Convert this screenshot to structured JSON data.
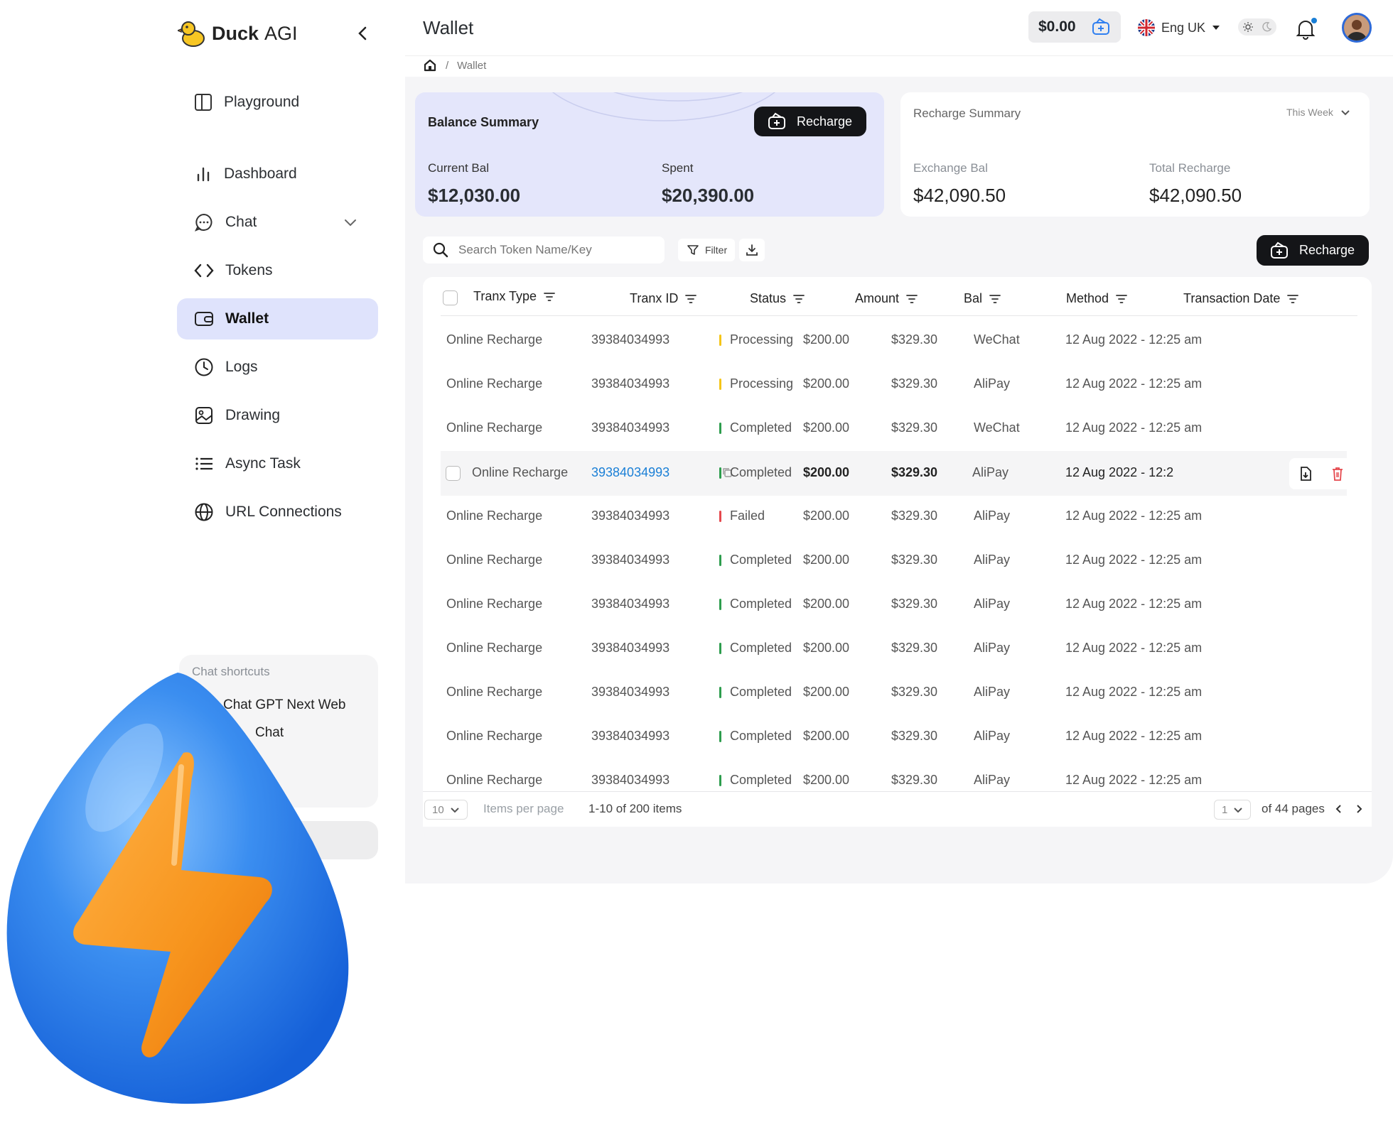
{
  "app": {
    "brand_main": "Duck",
    "brand_accent": "AGI"
  },
  "sidebar": {
    "items": [
      {
        "label": "Playground",
        "icon": "layout-icon"
      },
      {
        "label": "Dashboard",
        "icon": "bar-chart-icon"
      },
      {
        "label": "Chat",
        "icon": "chat-bubble-icon"
      },
      {
        "label": "Tokens",
        "icon": "code-icon"
      },
      {
        "label": "Wallet",
        "icon": "wallet-icon"
      },
      {
        "label": "Logs",
        "icon": "clock-icon"
      },
      {
        "label": "Drawing",
        "icon": "image-icon"
      },
      {
        "label": "Async Task",
        "icon": "list-icon"
      },
      {
        "label": "URL Connections",
        "icon": "globe-icon"
      }
    ],
    "active": "Wallet",
    "shortcuts": {
      "title": "Chat shortcuts",
      "items": [
        "Chat GPT Next Web",
        "Chat"
      ]
    }
  },
  "header": {
    "title": "Wallet",
    "balance": "$0.00",
    "language": "Eng UK",
    "breadcrumb": [
      "Wallet"
    ]
  },
  "balance_summary": {
    "title": "Balance Summary",
    "recharge_label": "Recharge",
    "current_label": "Current Bal",
    "current_value": "$12,030.00",
    "spent_label": "Spent",
    "spent_value": "$20,390.00"
  },
  "recharge_summary": {
    "title": "Recharge Summary",
    "period": "This Week",
    "exchange_label": "Exchange Bal",
    "exchange_value": "$42,090.50",
    "total_label": "Total Recharge",
    "total_value": "$42,090.50"
  },
  "toolbar": {
    "search_placeholder": "Search Token Name/Key",
    "filter_label": "Filter",
    "recharge_label": "Recharge"
  },
  "table": {
    "columns": [
      "Tranx Type",
      "Tranx ID",
      "Status",
      "Amount",
      "Bal",
      "Method",
      "Transaction Date"
    ],
    "rows": [
      {
        "type": "Online Recharge",
        "id": "39384034993",
        "status": "Processing",
        "amount": "$200.00",
        "bal": "$329.30",
        "method": "WeChat",
        "date": "12 Aug 2022 - 12:25 am"
      },
      {
        "type": "Online Recharge",
        "id": "39384034993",
        "status": "Processing",
        "amount": "$200.00",
        "bal": "$329.30",
        "method": "AliPay",
        "date": "12 Aug 2022 - 12:25 am"
      },
      {
        "type": "Online Recharge",
        "id": "39384034993",
        "status": "Completed",
        "amount": "$200.00",
        "bal": "$329.30",
        "method": "WeChat",
        "date": "12 Aug 2022 - 12:25 am"
      },
      {
        "type": "Online Recharge",
        "id": "39384034993",
        "status": "Completed",
        "amount": "$200.00",
        "bal": "$329.30",
        "method": "AliPay",
        "date": "12 Aug 2022 - 12:2"
      },
      {
        "type": "Online Recharge",
        "id": "39384034993",
        "status": "Failed",
        "amount": "$200.00",
        "bal": "$329.30",
        "method": "AliPay",
        "date": "12 Aug 2022 - 12:25 am"
      },
      {
        "type": "Online Recharge",
        "id": "39384034993",
        "status": "Completed",
        "amount": "$200.00",
        "bal": "$329.30",
        "method": "AliPay",
        "date": "12 Aug 2022 - 12:25 am"
      },
      {
        "type": "Online Recharge",
        "id": "39384034993",
        "status": "Completed",
        "amount": "$200.00",
        "bal": "$329.30",
        "method": "AliPay",
        "date": "12 Aug 2022 - 12:25 am"
      },
      {
        "type": "Online Recharge",
        "id": "39384034993",
        "status": "Completed",
        "amount": "$200.00",
        "bal": "$329.30",
        "method": "AliPay",
        "date": "12 Aug 2022 - 12:25 am"
      },
      {
        "type": "Online Recharge",
        "id": "39384034993",
        "status": "Completed",
        "amount": "$200.00",
        "bal": "$329.30",
        "method": "AliPay",
        "date": "12 Aug 2022 - 12:25 am"
      },
      {
        "type": "Online Recharge",
        "id": "39384034993",
        "status": "Completed",
        "amount": "$200.00",
        "bal": "$329.30",
        "method": "AliPay",
        "date": "12 Aug 2022 - 12:25 am"
      },
      {
        "type": "Online Recharge",
        "id": "39384034993",
        "status": "Completed",
        "amount": "$200.00",
        "bal": "$329.30",
        "method": "AliPay",
        "date": "12 Aug 2022 - 12:25 am"
      }
    ],
    "highlighted_row": 3,
    "status_colors": {
      "Processing": "#f5c518",
      "Completed": "#2e9d4e",
      "Failed": "#e5484d"
    }
  },
  "pagination": {
    "per_page": "10",
    "per_page_label": "Items per page",
    "range_label": "1-10 of 200 items",
    "page": "1",
    "pages_label": "of 44 pages"
  },
  "colors": {
    "accent": "#dfe3fc",
    "dark_button": "#141518",
    "link": "#1a7fd6"
  }
}
